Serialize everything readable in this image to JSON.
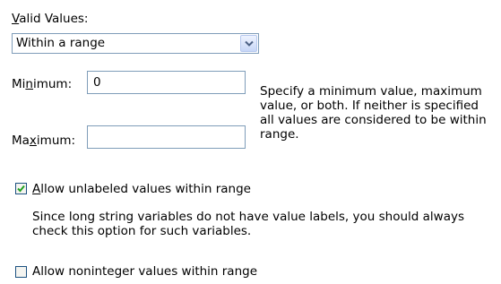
{
  "valid_values": {
    "label_mnemonic": "V",
    "label_rest": "alid Values:",
    "selected": "Within a range"
  },
  "minimum": {
    "label_pre": "Mi",
    "label_mnemonic": "n",
    "label_post": "imum:",
    "value": "0"
  },
  "maximum": {
    "label_pre": "Ma",
    "label_mnemonic": "x",
    "label_post": "imum:",
    "value": ""
  },
  "range_help": {
    "line1": "Specify a minimum value, maximum",
    "line2": "value, or both. If neither is specified",
    "line3": "all values are considered to be within",
    "line4": "range."
  },
  "allow_unlabeled": {
    "checked": true,
    "label_mnemonic": "A",
    "label_rest": "llow unlabeled values within range",
    "help_line1": "Since long string variables do not have value labels, you should always",
    "help_line2": "check this option for such variables."
  },
  "allow_noninteger": {
    "checked": false,
    "label_mnemonic": "",
    "label_rest": "Allow noninteger values within range"
  },
  "colors": {
    "field_border": "#7f9db9",
    "check_border": "#1c5180",
    "check_mark": "#21a121"
  },
  "icons": {
    "dropdown": "chevron-down-icon",
    "check": "checkmark-icon"
  }
}
